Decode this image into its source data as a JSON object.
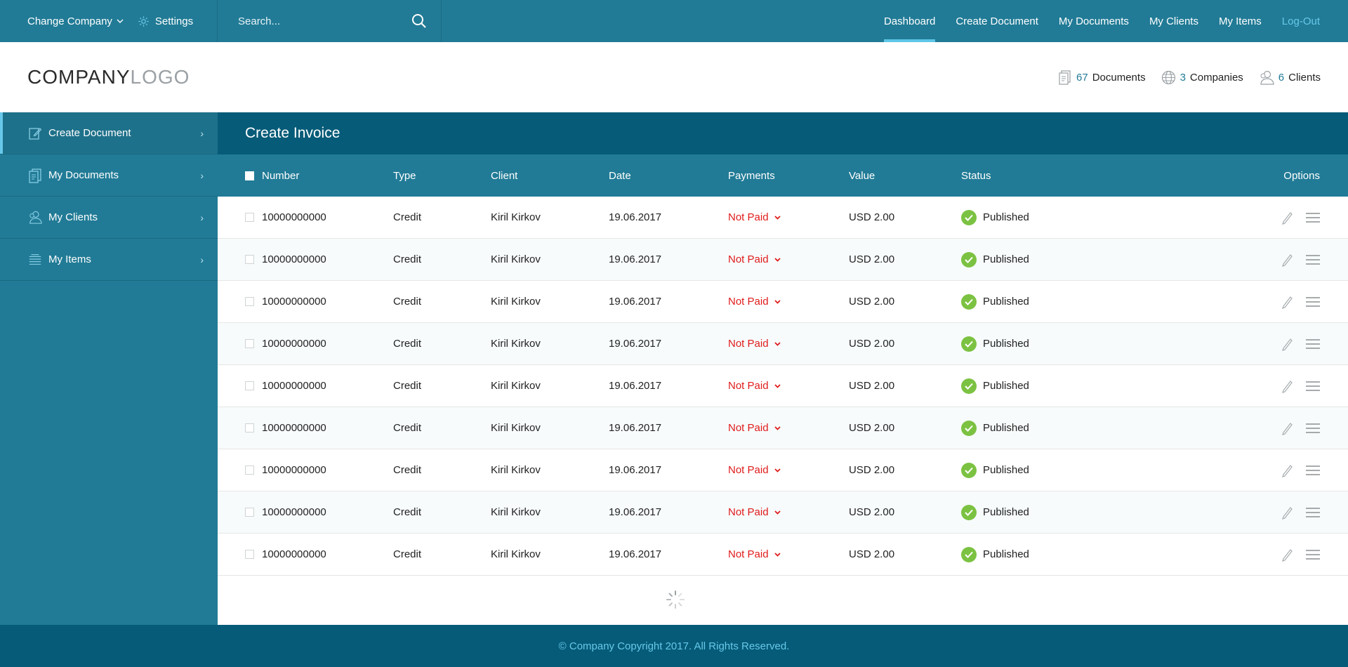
{
  "topbar": {
    "change_company": "Change Company",
    "settings": "Settings",
    "search_placeholder": "Search...",
    "nav": [
      "Dashboard",
      "Create Document",
      "My Documents",
      "My Clients",
      "My Items",
      "Log-Out"
    ],
    "active_nav": "Dashboard"
  },
  "header": {
    "logo_dark": "COMPANY",
    "logo_light": "LOGO",
    "stats": {
      "documents": {
        "num": "67",
        "label": "Documents"
      },
      "companies": {
        "num": "3",
        "label": "Companies"
      },
      "clients": {
        "num": "6",
        "label": "Clients"
      }
    }
  },
  "sidebar": {
    "items": [
      {
        "label": "Create Document",
        "icon": "edit-document-icon",
        "active": true
      },
      {
        "label": "My Documents",
        "icon": "documents-icon",
        "active": false
      },
      {
        "label": "My Clients",
        "icon": "clients-icon",
        "active": false
      },
      {
        "label": "My Items",
        "icon": "items-icon",
        "active": false
      }
    ]
  },
  "main": {
    "title": "Create Invoice",
    "columns": {
      "number": "Number",
      "type": "Type",
      "client": "Client",
      "date": "Date",
      "payments": "Payments",
      "value": "Value",
      "status": "Status",
      "options": "Options"
    },
    "rows": [
      {
        "number": "10000000000",
        "type": "Credit",
        "client": "Kiril Kirkov",
        "date": "19.06.2017",
        "payment": "Not Paid",
        "value": "USD 2.00",
        "status": "Published"
      },
      {
        "number": "10000000000",
        "type": "Credit",
        "client": "Kiril Kirkov",
        "date": "19.06.2017",
        "payment": "Not Paid",
        "value": "USD 2.00",
        "status": "Published"
      },
      {
        "number": "10000000000",
        "type": "Credit",
        "client": "Kiril Kirkov",
        "date": "19.06.2017",
        "payment": "Not Paid",
        "value": "USD 2.00",
        "status": "Published"
      },
      {
        "number": "10000000000",
        "type": "Credit",
        "client": "Kiril Kirkov",
        "date": "19.06.2017",
        "payment": "Not Paid",
        "value": "USD 2.00",
        "status": "Published"
      },
      {
        "number": "10000000000",
        "type": "Credit",
        "client": "Kiril Kirkov",
        "date": "19.06.2017",
        "payment": "Not Paid",
        "value": "USD 2.00",
        "status": "Published"
      },
      {
        "number": "10000000000",
        "type": "Credit",
        "client": "Kiril Kirkov",
        "date": "19.06.2017",
        "payment": "Not Paid",
        "value": "USD 2.00",
        "status": "Published"
      },
      {
        "number": "10000000000",
        "type": "Credit",
        "client": "Kiril Kirkov",
        "date": "19.06.2017",
        "payment": "Not Paid",
        "value": "USD 2.00",
        "status": "Published"
      },
      {
        "number": "10000000000",
        "type": "Credit",
        "client": "Kiril Kirkov",
        "date": "19.06.2017",
        "payment": "Not Paid",
        "value": "USD 2.00",
        "status": "Published"
      },
      {
        "number": "10000000000",
        "type": "Credit",
        "client": "Kiril Kirkov",
        "date": "19.06.2017",
        "payment": "Not Paid",
        "value": "USD 2.00",
        "status": "Published"
      }
    ]
  },
  "footer": {
    "copyright": "© Company Copyright 2017. All Rights Reserved."
  },
  "colors": {
    "primary": "#217b96",
    "dark": "#055b78",
    "accent": "#67c8ea",
    "not_paid": "#e01b1b",
    "published": "#7cc242"
  }
}
